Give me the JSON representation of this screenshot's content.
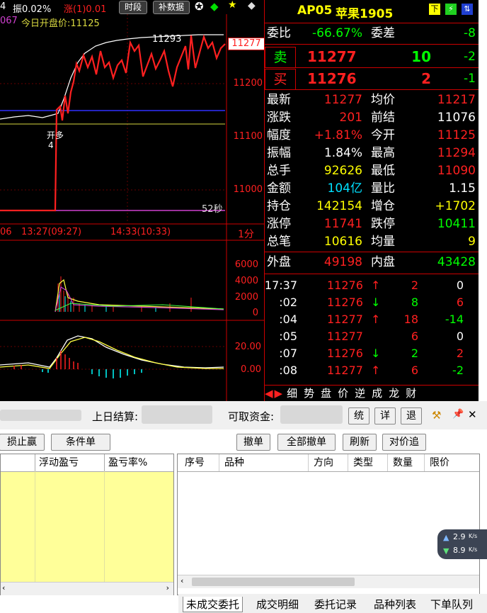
{
  "chart": {
    "top_left_fragment": "4",
    "amplitude": "振0.02%",
    "rise": "涨(1)0.01",
    "time_btn": "时段",
    "supplement_btn": "补数据",
    "open_price_prefix": "067",
    "open_price_label": "今日开盘价:11125",
    "high_label": "11293",
    "current_tag": "11277",
    "y_labels": [
      "11200",
      "11100",
      "11000"
    ],
    "seconds_label": "52秒",
    "open_long_label": "开多",
    "open_long_count": "4",
    "time_axis": [
      "06",
      "13:27(09:27)",
      "14:33(10:33)"
    ],
    "period_label": "1分",
    "vol_labels": [
      "6000",
      "4000",
      "2000",
      "0"
    ],
    "macd_labels": [
      "20.00",
      "0.00"
    ],
    "colors": {
      "price": "#ff2020",
      "white_line": "#ffffff",
      "blue_line": "#3030ff",
      "yellow_line": "#d8d840",
      "purple_line": "#d040d0"
    }
  },
  "quote": {
    "contract": "AP05",
    "name": "苹果1905",
    "rows": [
      {
        "l1": "委比",
        "v1": "-66.67%",
        "c1": "#00ff00",
        "l2": "委差",
        "v2": "-8",
        "c2": "#00ff00"
      }
    ],
    "sell": {
      "label": "卖",
      "price": "11277",
      "qty": "10",
      "chg": "-2"
    },
    "buy": {
      "label": "买",
      "price": "11276",
      "qty": "2",
      "chg": "-1"
    },
    "stats": [
      {
        "l1": "最新",
        "v1": "11277",
        "c1": "#ff2020",
        "l2": "均价",
        "v2": "11217",
        "c2": "#ff2020"
      },
      {
        "l1": "涨跌",
        "v1": "201",
        "c1": "#ff2020",
        "l2": "前结",
        "v2": "11076",
        "c2": "#ffffff"
      },
      {
        "l1": "幅度",
        "v1": "+1.81%",
        "c1": "#ff2020",
        "l2": "今开",
        "v2": "11125",
        "c2": "#ff2020"
      },
      {
        "l1": "振幅",
        "v1": "1.84%",
        "c1": "#ffffff",
        "l2": "最高",
        "v2": "11294",
        "c2": "#ff2020"
      },
      {
        "l1": "总手",
        "v1": "92626",
        "c1": "#ffff00",
        "l2": "最低",
        "v2": "11090",
        "c2": "#ff2020"
      },
      {
        "l1": "金额",
        "v1": "104亿",
        "c1": "#00e0ff",
        "l2": "量比",
        "v2": "1.15",
        "c2": "#ffffff"
      },
      {
        "l1": "持仓",
        "v1": "142154",
        "c1": "#ffff00",
        "l2": "增仓",
        "v2": "+1702",
        "c2": "#ffff00"
      },
      {
        "l1": "涨停",
        "v1": "11741",
        "c1": "#ff2020",
        "l2": "跌停",
        "v2": "10411",
        "c2": "#00ff00"
      },
      {
        "l1": "总笔",
        "v1": "10616",
        "c1": "#ffff00",
        "l2": "均量",
        "v2": "9",
        "c2": "#ffff00"
      }
    ],
    "outer": {
      "l1": "外盘",
      "v1": "49198",
      "l2": "内盘",
      "v2": "43428"
    },
    "ticks": [
      {
        "t": "17:37",
        "p": "11276",
        "a": "↑",
        "ac": "#ff2020",
        "q": "2",
        "qc": "#ff2020",
        "d": "0",
        "dc": "#ffffff"
      },
      {
        "t": ":02",
        "p": "11276",
        "a": "↓",
        "ac": "#00ff00",
        "q": "8",
        "qc": "#00ff00",
        "d": "6",
        "dc": "#ff2020"
      },
      {
        "t": ":04",
        "p": "11277",
        "a": "↑",
        "ac": "#ff2020",
        "q": "18",
        "qc": "#ff2020",
        "d": "-14",
        "dc": "#00ff00"
      },
      {
        "t": ":05",
        "p": "11277",
        "a": "",
        "ac": "#ff2020",
        "q": "6",
        "qc": "#ff2020",
        "d": "0",
        "dc": "#ffffff"
      },
      {
        "t": ":07",
        "p": "11276",
        "a": "↓",
        "ac": "#00ff00",
        "q": "2",
        "qc": "#00ff00",
        "d": "2",
        "dc": "#ff2020"
      },
      {
        "t": ":08",
        "p": "11277",
        "a": "↑",
        "ac": "#ff2020",
        "q": "6",
        "qc": "#ff2020",
        "d": "-2",
        "dc": "#00ff00"
      }
    ],
    "tabs": [
      "细",
      "势",
      "盘",
      "价",
      "逆",
      "成",
      "龙",
      "财"
    ]
  },
  "trade": {
    "settle_label": "上日结算:",
    "available_label": "可取资金:",
    "btn_tong": "统",
    "btn_xiang": "详",
    "btn_tui": "退",
    "btn_stop": "损止赢",
    "btn_cond": "条件单",
    "btn_cancel": "撤单",
    "btn_cancel_all": "全部撤单",
    "btn_refresh": "刷新",
    "btn_counter": "对价追",
    "left_cols": [
      "浮动盈亏",
      "盈亏率%"
    ],
    "right_cols": [
      "序号",
      "品种",
      "方向",
      "类型",
      "数量",
      "限价"
    ],
    "net_up": "2.9",
    "net_down": "8.9",
    "net_unit": "K/s",
    "bottom_tabs": [
      "未成交委托",
      "成交明细",
      "委托记录",
      "品种列表",
      "下单队列"
    ]
  }
}
